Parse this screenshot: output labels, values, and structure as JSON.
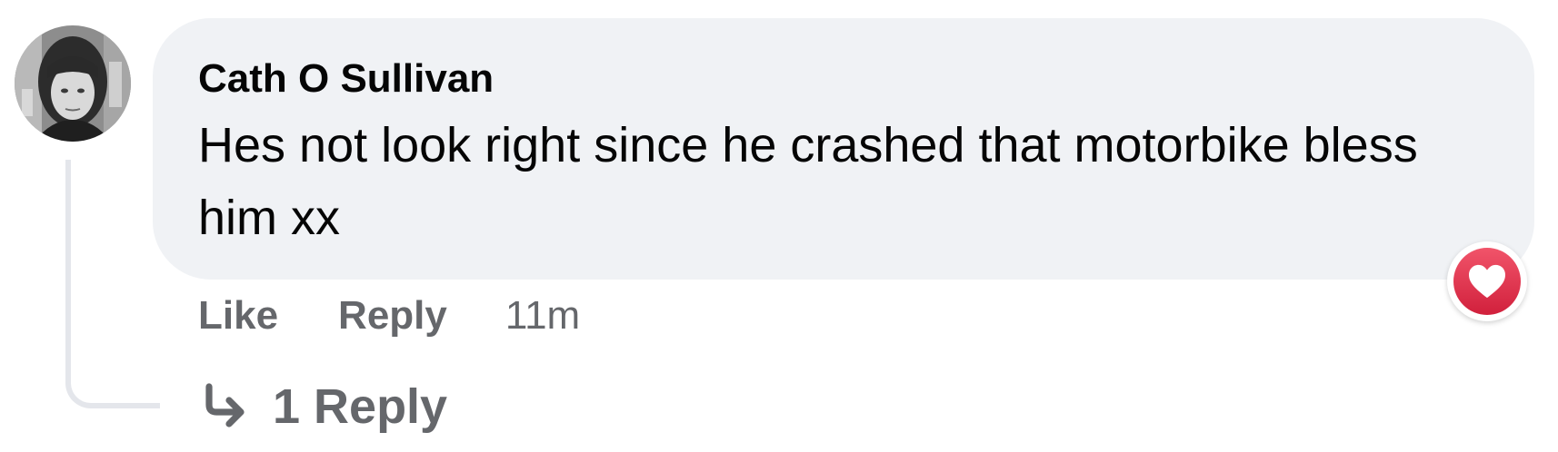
{
  "comment": {
    "author": "Cath O Sullivan",
    "text": "Hes not look right since he crashed that motorbike bless him xx",
    "timestamp": "11m",
    "reaction": {
      "icon": "heart-icon",
      "color": "#e41e3f"
    }
  },
  "actions": {
    "like_label": "Like",
    "reply_label": "Reply"
  },
  "replies": {
    "icon": "reply-arrow-icon",
    "label": "1 Reply"
  },
  "colors": {
    "bubble": "#f0f2f5",
    "secondary_text": "#65676b",
    "primary_text": "#050505"
  }
}
